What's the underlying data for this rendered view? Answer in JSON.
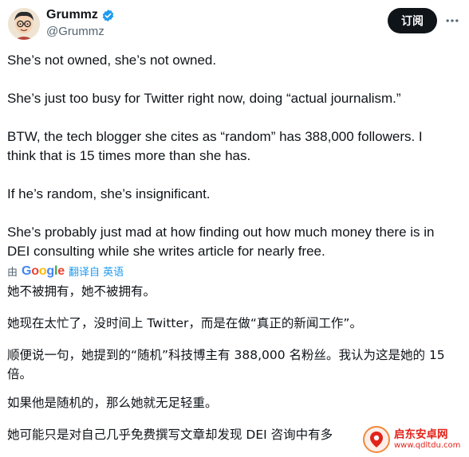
{
  "author": {
    "display_name": "Grummz",
    "handle": "@Grummz",
    "verified": true,
    "avatar_icon": "cartoon-avatar-icon"
  },
  "actions": {
    "subscribe_label": "订阅",
    "more_icon": "more-horizontal-icon"
  },
  "tweet": {
    "paragraphs": [
      "She’s not owned, she’s not owned.",
      "She’s just too busy for Twitter right now, doing “actual journalism.”",
      "BTW, the tech blogger she cites as “random” has 388,000 followers. I think that is 15 times more than she has.",
      "If he’s random, she’s insignificant.",
      "She’s probably just mad at how finding out how much money there is in DEI consulting while she writes article for nearly free."
    ]
  },
  "translation": {
    "by_label": "由",
    "provider": "Google",
    "link_label": "翻译自 英语",
    "paragraphs": [
      "她不被拥有，她不被拥有。",
      "她现在太忙了，没时间上 Twitter，而是在做“真正的新闻工作”。",
      "顺便说一句，她提到的“随机”科技博主有 388,000 名粉丝。我认为这是她的 15 倍。",
      "如果他是随机的，那么她就无足轻重。",
      "她可能只是对自己几乎免费撰写文章却发现 DEI 咨询中有多"
    ]
  },
  "watermark": {
    "title": "启东安卓网",
    "url": "www.qdltdu.com"
  },
  "colors": {
    "text": "#0f1419",
    "secondary": "#536471",
    "link": "#1d9bf0",
    "verified": "#1d9bf0",
    "button_bg": "#0f1419",
    "watermark": "#e2231a"
  }
}
